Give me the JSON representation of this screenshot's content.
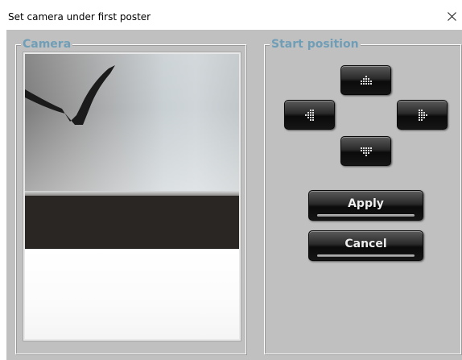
{
  "window": {
    "title": "Set camera under first poster",
    "close_icon": "close-icon"
  },
  "camera_group": {
    "legend": "Camera"
  },
  "start_group": {
    "legend": "Start position",
    "arrows": {
      "up_icon": "arrow-up-icon",
      "left_icon": "arrow-left-icon",
      "right_icon": "arrow-right-icon",
      "down_icon": "arrow-down-icon"
    },
    "apply_label": "Apply",
    "cancel_label": "Cancel"
  },
  "colors": {
    "legend": "#6f9eb6",
    "panel": "#c0c0c0",
    "button": "#151515"
  }
}
